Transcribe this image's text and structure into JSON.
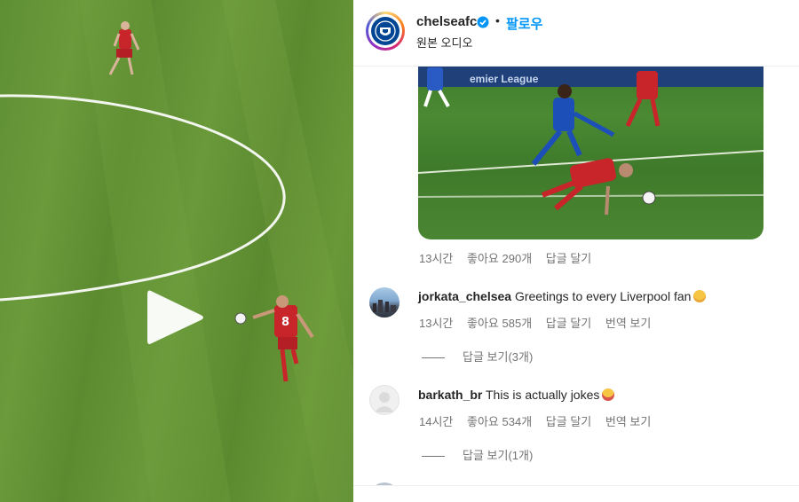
{
  "post": {
    "username": "chelseafc",
    "separator": "•",
    "follow_label": "팔로우",
    "audio_label": "원본 오디오",
    "brand_color": "#034694",
    "verified_icon": "verified-badge-icon",
    "follow_color": "#0095f6"
  },
  "media": {
    "board_text": "emier League",
    "caption_meta": {
      "time": "13시간",
      "likes": "좋아요 290개",
      "reply": "답글 달기"
    }
  },
  "video": {
    "play_icon": "play-icon",
    "player_number": "8"
  },
  "comments": [
    {
      "username": "jorkata_chelsea",
      "text": "Greetings to every Liverpool fan",
      "emoji": "smiling-face-icon",
      "time": "13시간",
      "likes": "좋아요 585개",
      "reply": "답글 달기",
      "translate": "번역 보기",
      "view_replies": "답글 보기(3개)"
    },
    {
      "username": "barkath_br",
      "text": "This is actually jokes",
      "emoji": "laughing-face-icon",
      "time": "14시간",
      "likes": "좋아요 534개",
      "reply": "답글 달기",
      "translate": "번역 보기",
      "view_replies": "답글 보기(1개)"
    }
  ]
}
